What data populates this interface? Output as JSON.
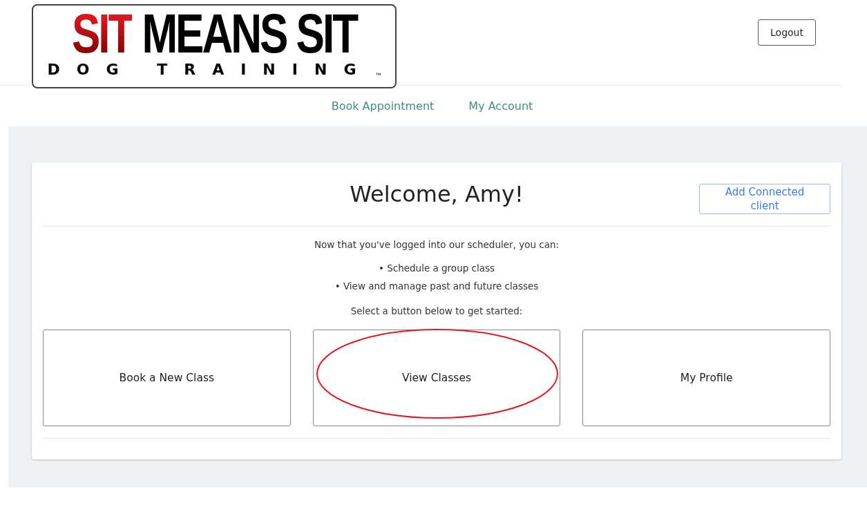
{
  "logo": {
    "red_word": "SIT",
    "black_words": "MEANS SIT",
    "tagline": "DOG TRAINING",
    "trademark": "™"
  },
  "header": {
    "logout": "Logout"
  },
  "nav": [
    {
      "label": "Book Appointment"
    },
    {
      "label": "My Account"
    }
  ],
  "card": {
    "title": "Welcome, Amy!",
    "add_client": "Add Connected client",
    "intro": "Now that you've logged into our scheduler, you can:",
    "bullets": [
      "• Schedule a group class",
      "• View and manage past and future classes"
    ],
    "prompt": "Select a button below to get started:",
    "tiles": [
      {
        "label": "Book a New Class",
        "circled": false
      },
      {
        "label": "View Classes",
        "circled": true
      },
      {
        "label": "My Profile",
        "circled": false
      }
    ]
  }
}
